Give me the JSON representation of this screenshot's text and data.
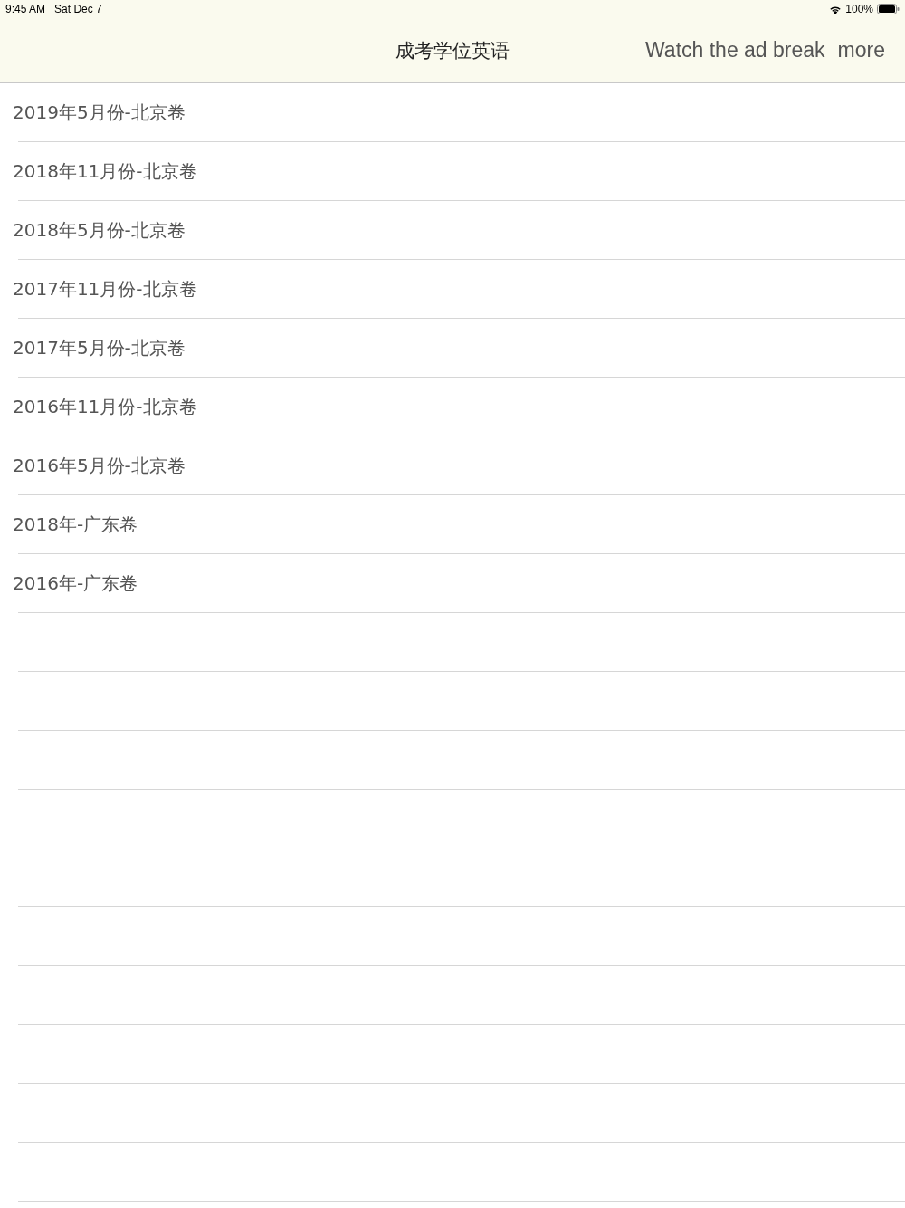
{
  "status_bar": {
    "time": "9:45 AM",
    "date": "Sat Dec 7",
    "battery": "100%"
  },
  "nav_bar": {
    "title": "成考学位英语",
    "buttons": [
      "Watch the ad break",
      "more"
    ]
  },
  "list": [
    {
      "label": "2019年5月份-北京卷"
    },
    {
      "label": "2018年11月份-北京卷"
    },
    {
      "label": "2018年5月份-北京卷"
    },
    {
      "label": "2017年11月份-北京卷"
    },
    {
      "label": "2017年5月份-北京卷"
    },
    {
      "label": "2016年11月份-北京卷"
    },
    {
      "label": "2016年5月份-北京卷"
    },
    {
      "label": "2018年-广东卷"
    },
    {
      "label": "2016年-广东卷"
    }
  ]
}
